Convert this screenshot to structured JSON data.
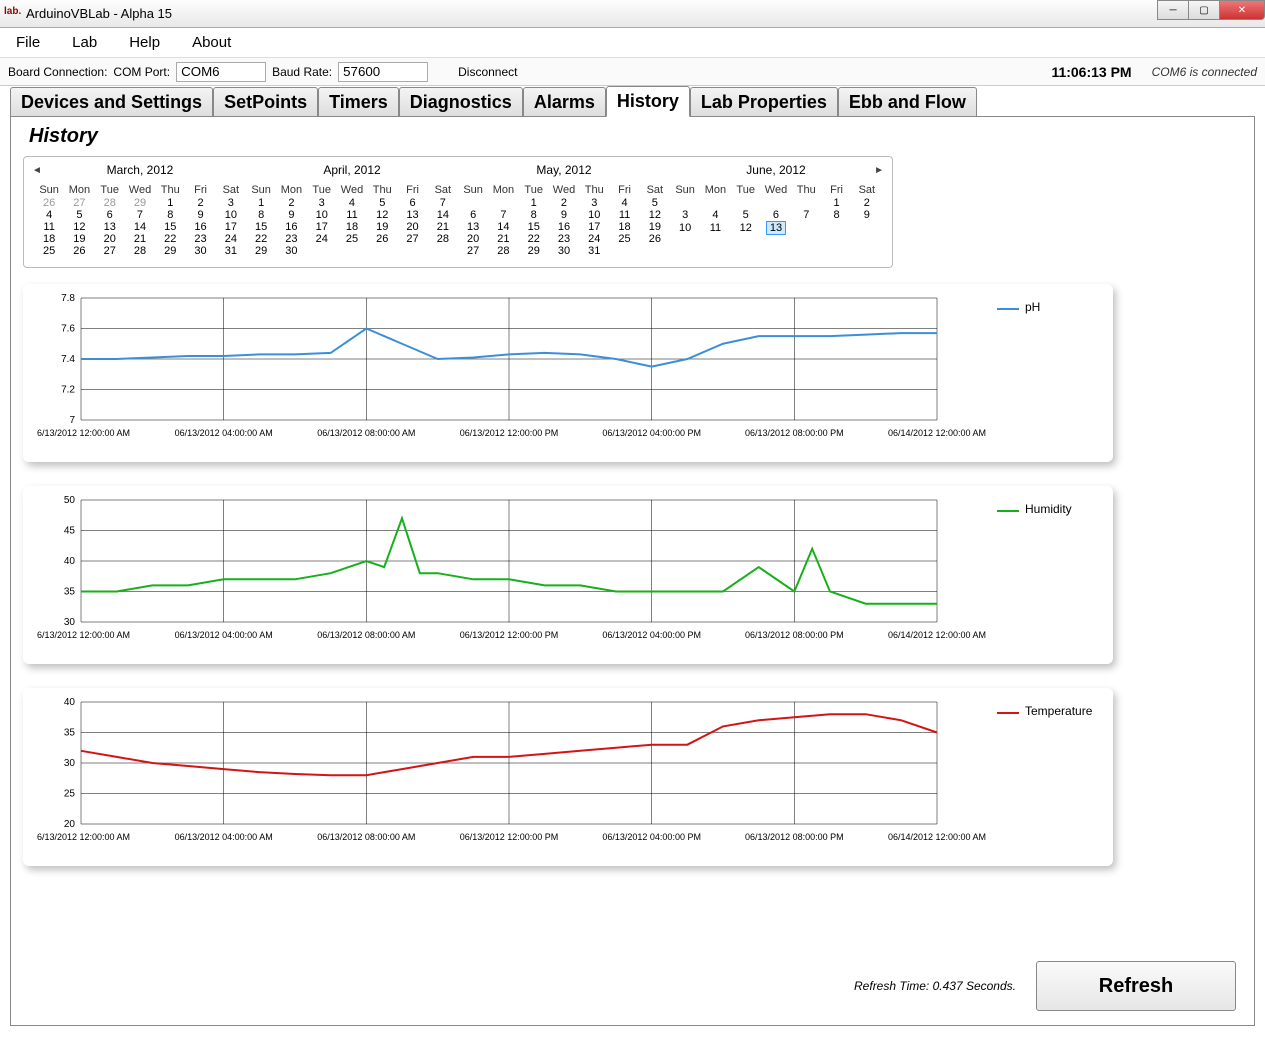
{
  "window": {
    "title": "ArduinoVBLab - Alpha 15"
  },
  "menu": {
    "file": "File",
    "lab": "Lab",
    "help": "Help",
    "about": "About"
  },
  "conn": {
    "board_label": "Board Connection:",
    "com_label": "COM Port:",
    "com_value": "COM6",
    "baud_label": "Baud Rate:",
    "baud_value": "57600",
    "disconnect": "Disconnect",
    "clock": "11:06:13 PM",
    "status": "COM6 is connected"
  },
  "tabs": [
    "Devices and Settings",
    "SetPoints",
    "Timers",
    "Diagnostics",
    "Alarms",
    "History",
    "Lab Properties",
    "Ebb and Flow"
  ],
  "active_tab": 5,
  "page_title": "History",
  "calendar": {
    "dow": [
      "Sun",
      "Mon",
      "Tue",
      "Wed",
      "Thu",
      "Fri",
      "Sat"
    ],
    "months": [
      {
        "name": "March, 2012",
        "rows": [
          [
            "26",
            "27",
            "28",
            "29",
            "1",
            "2",
            "3"
          ],
          [
            "4",
            "5",
            "6",
            "7",
            "8",
            "9",
            "10"
          ],
          [
            "11",
            "12",
            "13",
            "14",
            "15",
            "16",
            "17"
          ],
          [
            "18",
            "19",
            "20",
            "21",
            "22",
            "23",
            "24"
          ],
          [
            "25",
            "26",
            "27",
            "28",
            "29",
            "30",
            "31"
          ]
        ],
        "dim": [
          [
            0,
            0
          ],
          [
            0,
            1
          ],
          [
            0,
            2
          ],
          [
            0,
            3
          ]
        ]
      },
      {
        "name": "April, 2012",
        "rows": [
          [
            "1",
            "2",
            "3",
            "4",
            "5",
            "6",
            "7"
          ],
          [
            "8",
            "9",
            "10",
            "11",
            "12",
            "13",
            "14"
          ],
          [
            "15",
            "16",
            "17",
            "18",
            "19",
            "20",
            "21"
          ],
          [
            "22",
            "23",
            "24",
            "25",
            "26",
            "27",
            "28"
          ],
          [
            "29",
            "30",
            "",
            "",
            "",
            "",
            ""
          ]
        ],
        "dim": []
      },
      {
        "name": "May, 2012",
        "rows": [
          [
            "",
            "",
            "1",
            "2",
            "3",
            "4",
            "5"
          ],
          [
            "6",
            "7",
            "8",
            "9",
            "10",
            "11",
            "12"
          ],
          [
            "13",
            "14",
            "15",
            "16",
            "17",
            "18",
            "19"
          ],
          [
            "20",
            "21",
            "22",
            "23",
            "24",
            "25",
            "26"
          ],
          [
            "27",
            "28",
            "29",
            "30",
            "31",
            "",
            ""
          ]
        ],
        "dim": []
      },
      {
        "name": "June, 2012",
        "rows": [
          [
            "",
            "",
            "",
            "",
            "",
            "1",
            "2"
          ],
          [
            "3",
            "4",
            "5",
            "6",
            "7",
            "8",
            "9"
          ],
          [
            "10",
            "11",
            "12",
            "13",
            "",
            "",
            ""
          ],
          [
            "",
            "",
            "",
            "",
            "",
            "",
            ""
          ],
          [
            "",
            "",
            "",
            "",
            "",
            "",
            ""
          ]
        ],
        "dim": [],
        "selected": [
          2,
          3
        ]
      }
    ]
  },
  "x_ticks": [
    "06/13/2012 12:00:00 AM",
    "06/13/2012 04:00:00 AM",
    "06/13/2012 08:00:00 AM",
    "06/13/2012 12:00:00 PM",
    "06/13/2012 04:00:00 PM",
    "06/13/2012 08:00:00 PM",
    "06/14/2012 12:00:00 AM"
  ],
  "refresh": {
    "time_label": "Refresh Time: 0.437 Seconds.",
    "button": "Refresh"
  },
  "chart_data": [
    {
      "type": "line",
      "name": "pH",
      "color": "#3a8fd8",
      "ylim": [
        7,
        7.8
      ],
      "yticks": [
        7,
        7.2,
        7.4,
        7.6,
        7.8
      ],
      "x_hours": [
        0,
        1,
        2,
        3,
        4,
        5,
        6,
        7,
        8,
        9,
        10,
        11,
        12,
        13,
        14,
        15,
        16,
        17,
        18,
        19,
        20,
        21,
        22,
        23,
        24
      ],
      "values": [
        7.4,
        7.4,
        7.41,
        7.42,
        7.42,
        7.43,
        7.43,
        7.44,
        7.6,
        7.5,
        7.4,
        7.41,
        7.43,
        7.44,
        7.43,
        7.4,
        7.35,
        7.4,
        7.5,
        7.55,
        7.55,
        7.55,
        7.56,
        7.57,
        7.57
      ]
    },
    {
      "type": "line",
      "name": "Humidity",
      "color": "#17b01a",
      "ylim": [
        30,
        50
      ],
      "yticks": [
        30,
        35,
        40,
        45,
        50
      ],
      "x_hours": [
        0,
        1,
        2,
        3,
        4,
        5,
        6,
        7,
        8,
        8.5,
        9,
        9.5,
        10,
        11,
        12,
        13,
        14,
        15,
        16,
        17,
        18,
        19,
        20,
        20.5,
        21,
        22,
        23,
        24
      ],
      "values": [
        35,
        35,
        36,
        36,
        37,
        37,
        37,
        38,
        40,
        39,
        47,
        38,
        38,
        37,
        37,
        36,
        36,
        35,
        35,
        35,
        35,
        39,
        35,
        42,
        35,
        33,
        33,
        33
      ]
    },
    {
      "type": "line",
      "name": "Temperature",
      "color": "#d31414",
      "ylim": [
        20,
        40
      ],
      "yticks": [
        20,
        25,
        30,
        35,
        40
      ],
      "x_hours": [
        0,
        1,
        2,
        3,
        4,
        5,
        6,
        7,
        8,
        9,
        10,
        11,
        12,
        13,
        14,
        15,
        16,
        17,
        18,
        19,
        20,
        21,
        22,
        23,
        24
      ],
      "values": [
        32,
        31,
        30,
        29.5,
        29,
        28.5,
        28.2,
        28,
        28,
        29,
        30,
        31,
        31,
        31.5,
        32,
        32.5,
        33,
        33,
        36,
        37,
        37.5,
        38,
        38,
        37,
        35
      ]
    }
  ]
}
